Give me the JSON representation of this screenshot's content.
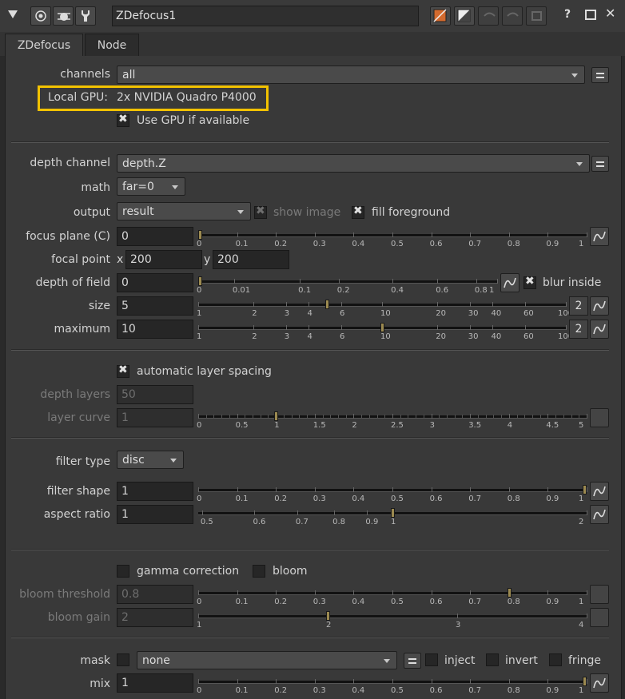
{
  "header": {
    "node_name": "ZDefocus1"
  },
  "tabs": [
    {
      "label": "ZDefocus"
    },
    {
      "label": "Node"
    }
  ],
  "channels": {
    "label": "channels",
    "value": "all"
  },
  "gpu": {
    "label": "Local GPU:",
    "value": "2x NVIDIA Quadro P4000",
    "use_gpu_label": "Use GPU if available",
    "use_gpu_checked": true
  },
  "depth_channel": {
    "label": "depth channel",
    "value": "depth.Z"
  },
  "math": {
    "label": "math",
    "value": "far=0"
  },
  "output": {
    "label": "output",
    "value": "result",
    "show_image_label": "show image",
    "show_image_checked": true,
    "fill_foreground_label": "fill foreground",
    "fill_foreground_checked": true
  },
  "focus_plane": {
    "label": "focus plane (C)",
    "value": "0",
    "ticks": [
      "0",
      "0.1",
      "0.2",
      "0.3",
      "0.4",
      "0.5",
      "0.6",
      "0.7",
      "0.8",
      "0.9",
      "1"
    ],
    "slider_value": 0
  },
  "focal_point": {
    "label": "focal point",
    "x_label": "x",
    "x": "200",
    "y_label": "y",
    "y": "200"
  },
  "depth_of_field": {
    "label": "depth of field",
    "value": "0",
    "ticks": [
      "0",
      "0.01",
      "0.1",
      "0.2",
      "0.4",
      "0.6",
      "0.8",
      "1"
    ],
    "slider_value": 0,
    "blur_inside_label": "blur inside",
    "blur_inside_checked": true
  },
  "size": {
    "label": "size",
    "value": "5",
    "ticks": [
      "1",
      "2",
      "3",
      "4",
      "6",
      "10",
      "20",
      "30",
      "40",
      "60",
      "100"
    ],
    "slider_value": 5,
    "dims": "2"
  },
  "maximum": {
    "label": "maximum",
    "value": "10",
    "ticks": [
      "1",
      "2",
      "3",
      "4",
      "6",
      "10",
      "20",
      "30",
      "40",
      "60",
      "100"
    ],
    "slider_value": 10,
    "dims": "2"
  },
  "auto_layer": {
    "label": "automatic layer spacing",
    "checked": true
  },
  "depth_layers": {
    "label": "depth layers",
    "value": "50"
  },
  "layer_curve": {
    "label": "layer curve",
    "value": "1",
    "ticks": [
      "0",
      "0.5",
      "1",
      "1.5",
      "2",
      "2.5",
      "3",
      "3.5",
      "4",
      "4.5",
      "5"
    ],
    "slider_value": 1
  },
  "filter_type": {
    "label": "filter type",
    "value": "disc"
  },
  "filter_shape": {
    "label": "filter shape",
    "value": "1",
    "ticks": [
      "0",
      "0.1",
      "0.2",
      "0.3",
      "0.4",
      "0.5",
      "0.6",
      "0.7",
      "0.8",
      "0.9",
      "1"
    ],
    "slider_value": 1
  },
  "aspect_ratio": {
    "label": "aspect ratio",
    "value": "1",
    "ticks": [
      "0.5",
      "0.6",
      "0.7",
      "0.8",
      "0.9",
      "1",
      "2"
    ],
    "slider_value": 1
  },
  "gamma": {
    "label": "gamma correction",
    "checked": false,
    "bloom_label": "bloom",
    "bloom_checked": false
  },
  "bloom_threshold": {
    "label": "bloom threshold",
    "value": "0.8",
    "ticks": [
      "0",
      "0.1",
      "0.2",
      "0.3",
      "0.4",
      "0.5",
      "0.6",
      "0.7",
      "0.8",
      "0.9",
      "1"
    ],
    "slider_value": 0.8
  },
  "bloom_gain": {
    "label": "bloom gain",
    "value": "2",
    "ticks": [
      "1",
      "2",
      "3",
      "4"
    ],
    "slider_value": 2
  },
  "mask": {
    "label": "mask",
    "value": "none",
    "inject_label": "inject",
    "invert_label": "invert",
    "fringe_label": "fringe"
  },
  "mix": {
    "label": "mix",
    "value": "1",
    "ticks": [
      "0",
      "0.1",
      "0.2",
      "0.3",
      "0.4",
      "0.5",
      "0.6",
      "0.7",
      "0.8",
      "0.9",
      "1"
    ],
    "slider_value": 1
  },
  "colors": {
    "highlight": "#f2c200",
    "handle": "#9c8a50",
    "panel": "#393939"
  }
}
